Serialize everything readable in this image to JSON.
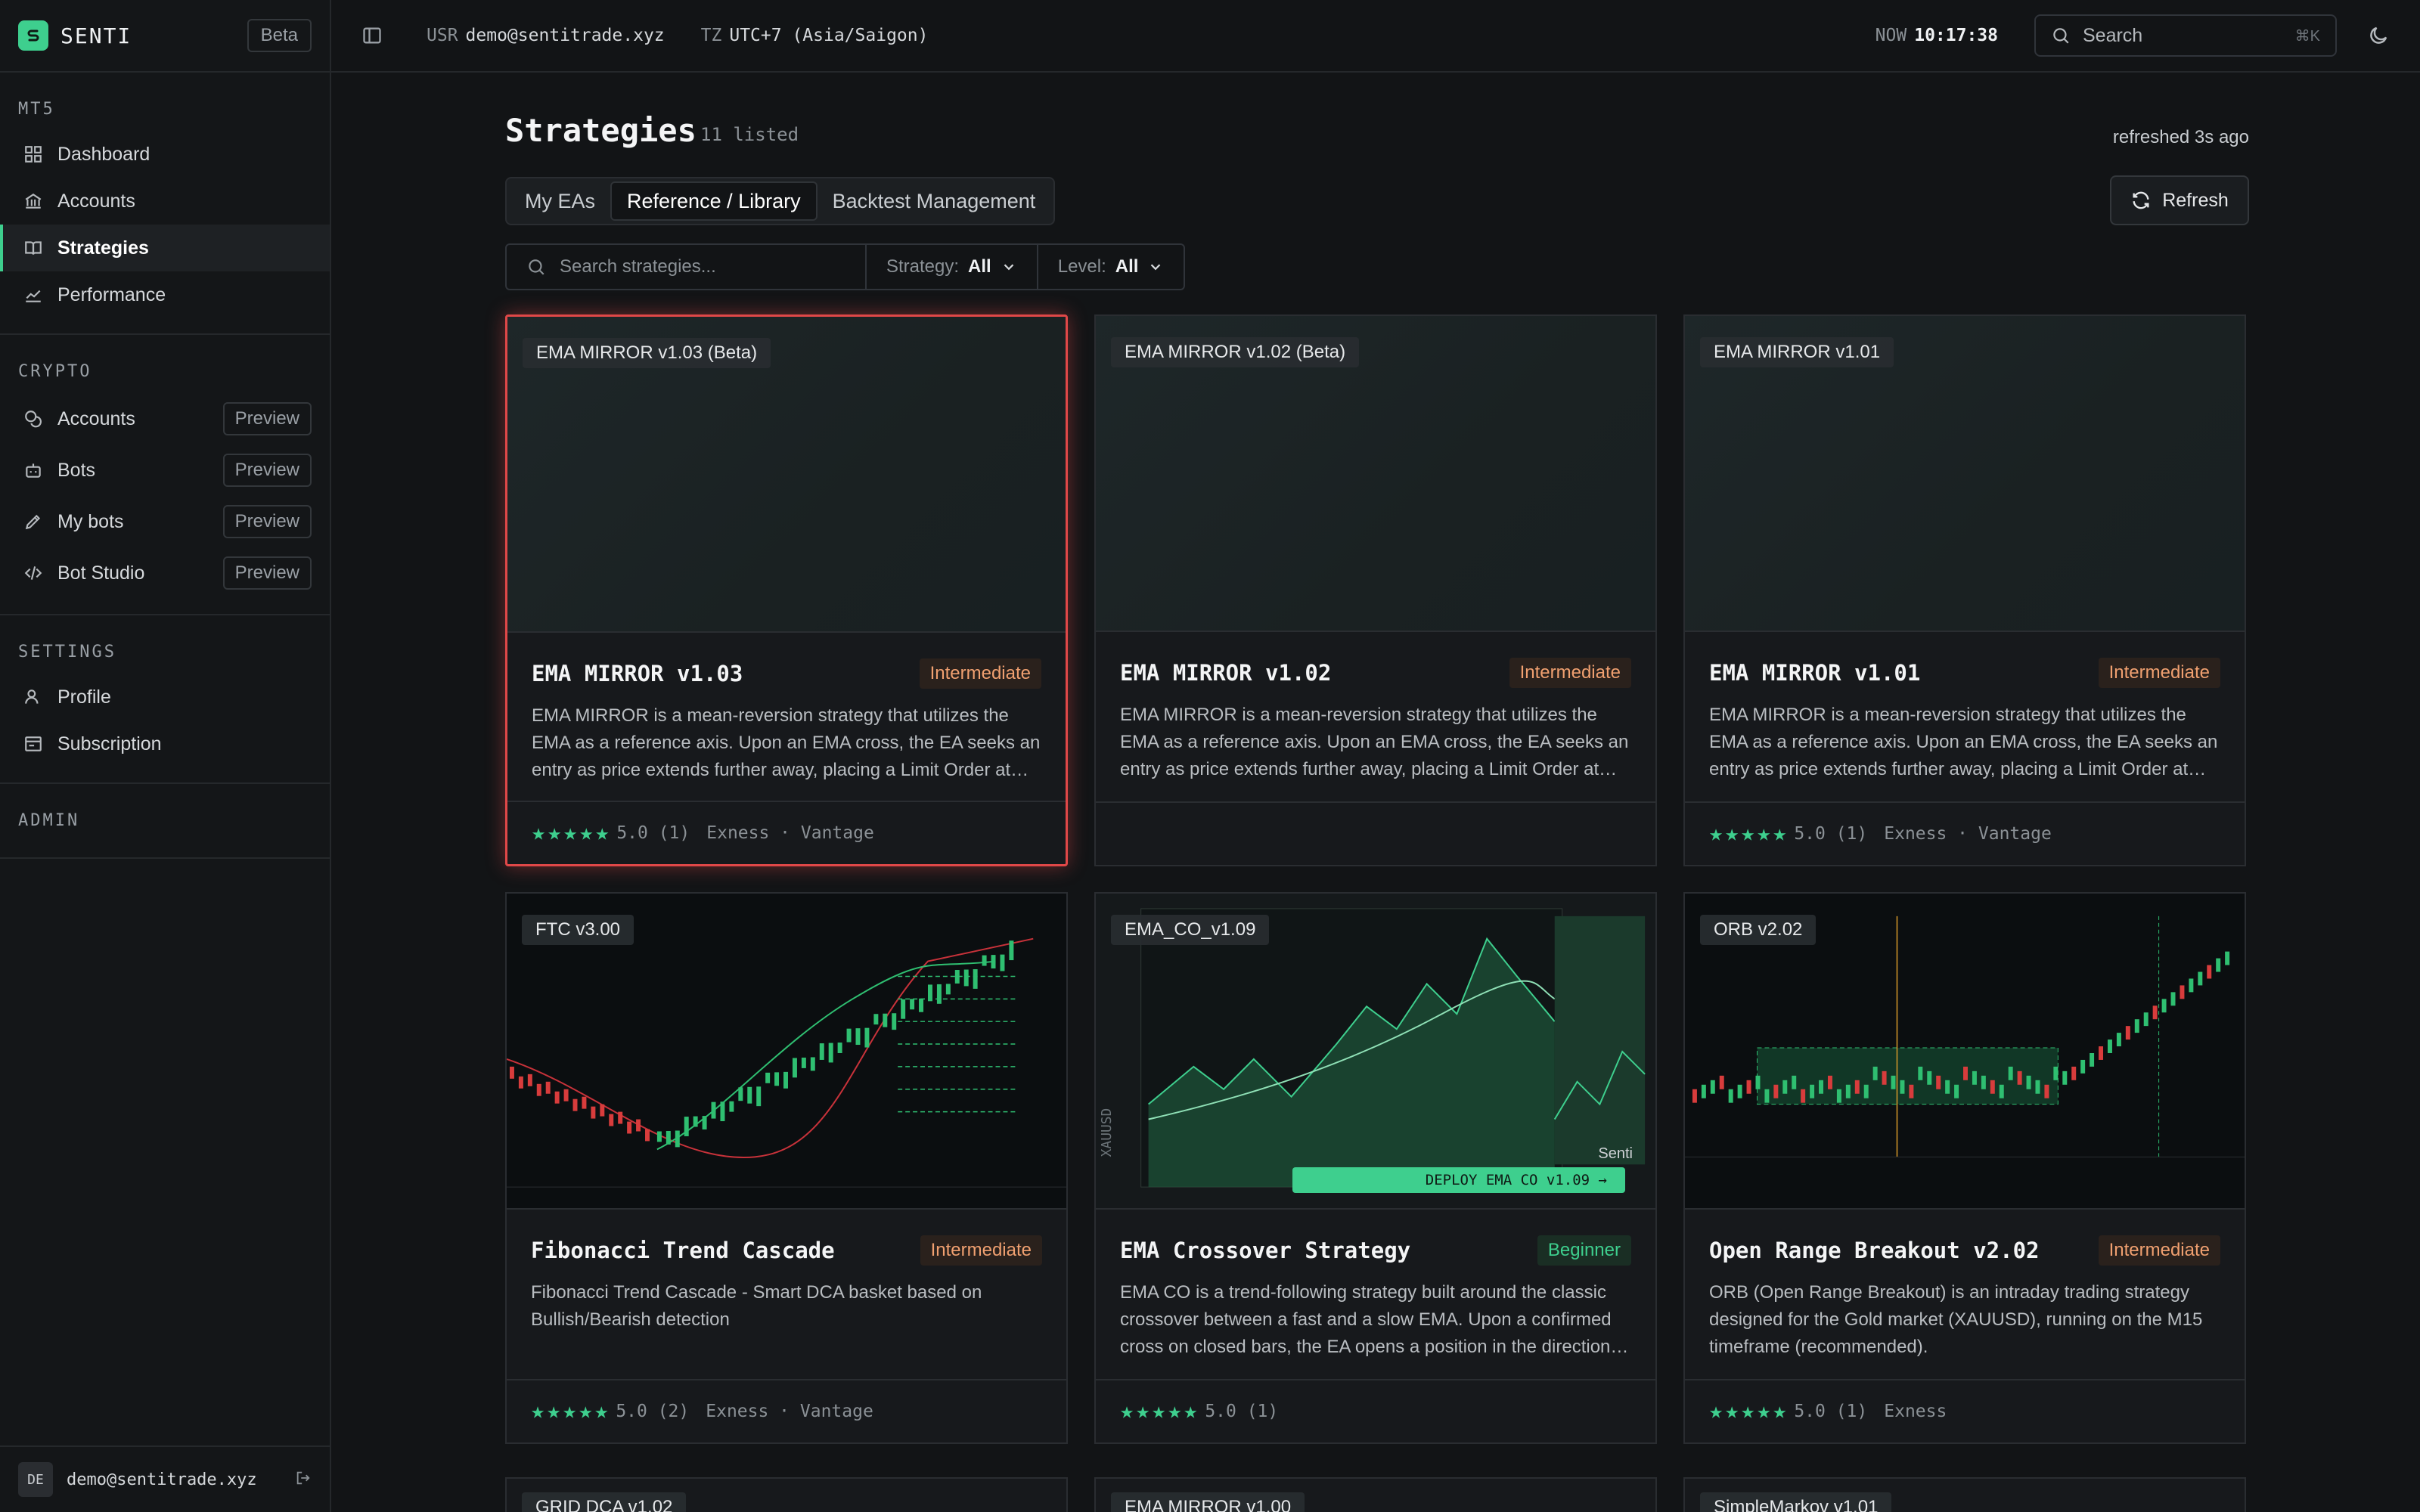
{
  "app": {
    "name": "SENTI",
    "badge": "Beta"
  },
  "topbar": {
    "usr_label": "USR",
    "usr_value": "demo@sentitrade.xyz",
    "tz_label": "TZ",
    "tz_value": "UTC+7 (Asia/Saigon)",
    "now_label": "NOW",
    "now_value": "10:17:38",
    "search_label": "Search",
    "search_kbd": "⌘K"
  },
  "sidebar": {
    "mt5_title": "MT5",
    "mt5_items": [
      {
        "label": "Dashboard",
        "icon": "grid-icon"
      },
      {
        "label": "Accounts",
        "icon": "bank-icon"
      },
      {
        "label": "Strategies",
        "icon": "book-icon",
        "active": true
      },
      {
        "label": "Performance",
        "icon": "chart-line-icon"
      }
    ],
    "crypto_title": "CRYPTO",
    "crypto_items": [
      {
        "label": "Accounts",
        "icon": "coins-icon",
        "tag": "Preview"
      },
      {
        "label": "Bots",
        "icon": "bot-icon",
        "tag": "Preview"
      },
      {
        "label": "My bots",
        "icon": "pen-icon",
        "tag": "Preview"
      },
      {
        "label": "Bot Studio",
        "icon": "code-icon",
        "tag": "Preview"
      }
    ],
    "settings_title": "SETTINGS",
    "settings_items": [
      {
        "label": "Profile",
        "icon": "user-icon"
      },
      {
        "label": "Subscription",
        "icon": "receipt-icon"
      }
    ],
    "admin_title": "ADMIN",
    "footer": {
      "initials": "DE",
      "email": "demo@sentitrade.xyz"
    }
  },
  "page": {
    "title": "Strategies",
    "count": "11 listed",
    "refreshed": "refreshed 3s ago",
    "refresh_label": "Refresh",
    "tabs": [
      "My EAs",
      "Reference / Library",
      "Backtest Management"
    ],
    "active_tab": 1,
    "search_placeholder": "Search strategies...",
    "filter_strategy_label": "Strategy:",
    "filter_strategy_value": "All",
    "filter_level_label": "Level:",
    "filter_level_value": "All"
  },
  "cards": [
    {
      "badge": "EMA MIRROR v1.03 (Beta)",
      "title": "EMA MIRROR v1.03",
      "level": "Intermediate",
      "desc": "EMA MIRROR is a mean-reversion strategy that utilizes the EMA as a reference axis. Upon an EMA cross, the EA seeks an entry as price extends further away, placing a Limit Order at…",
      "rating": "5.0 (1)",
      "brokers": "Exness · Vantage",
      "thumb": "blank",
      "selected": true
    },
    {
      "badge": "EMA MIRROR v1.02 (Beta)",
      "title": "EMA MIRROR v1.02",
      "level": "Intermediate",
      "desc": "EMA MIRROR is a mean-reversion strategy that utilizes the EMA as a reference axis. Upon an EMA cross, the EA seeks an entry as price extends further away, placing a Limit Order at…",
      "rating": "",
      "brokers": "",
      "thumb": "blank"
    },
    {
      "badge": "EMA MIRROR v1.01",
      "title": "EMA MIRROR v1.01",
      "level": "Intermediate",
      "desc": "EMA MIRROR is a mean-reversion strategy that utilizes the EMA as a reference axis. Upon an EMA cross, the EA seeks an entry as price extends further away, placing a Limit Order at…",
      "rating": "5.0 (1)",
      "brokers": "Exness · Vantage",
      "thumb": "blank"
    },
    {
      "badge": "FTC v3.00",
      "title": "Fibonacci Trend Cascade",
      "level": "Intermediate",
      "desc": "Fibonacci Trend Cascade - Smart DCA basket based on Bullish/Bearish detection",
      "rating": "5.0 (2)",
      "brokers": "Exness · Vantage",
      "thumb": "ftc"
    },
    {
      "badge": "EMA_CO_v1.09",
      "title": "EMA Crossover Strategy",
      "level": "Beginner",
      "desc": "EMA CO is a trend-following strategy built around the classic crossover between a fast and a slow EMA. Upon a confirmed cross on closed bars, the EA opens a position in the direction…",
      "rating": "5.0 (1)",
      "brokers": "",
      "thumb": "emaco",
      "deploy": "DEPLOY EMA CO v1.09 →",
      "brand": "Senti"
    },
    {
      "badge": "ORB v2.02",
      "title": "Open Range Breakout v2.02",
      "level": "Intermediate",
      "desc": "ORB (Open Range Breakout) is an intraday trading strategy designed for the Gold market (XAUUSD), running on the M15 timeframe (recommended).",
      "rating": "5.0 (1)",
      "brokers": "Exness",
      "thumb": "orb"
    }
  ],
  "peek_cards": [
    {
      "badge": "GRID DCA v1.02"
    },
    {
      "badge": "EMA MIRROR v1.00"
    },
    {
      "badge": "SimpleMarkov v1.01"
    }
  ],
  "colors": {
    "accent": "#3ecf8e",
    "selected_border": "#e04848",
    "intermediate": "#f0a070",
    "beginner": "#3ecf8e"
  }
}
